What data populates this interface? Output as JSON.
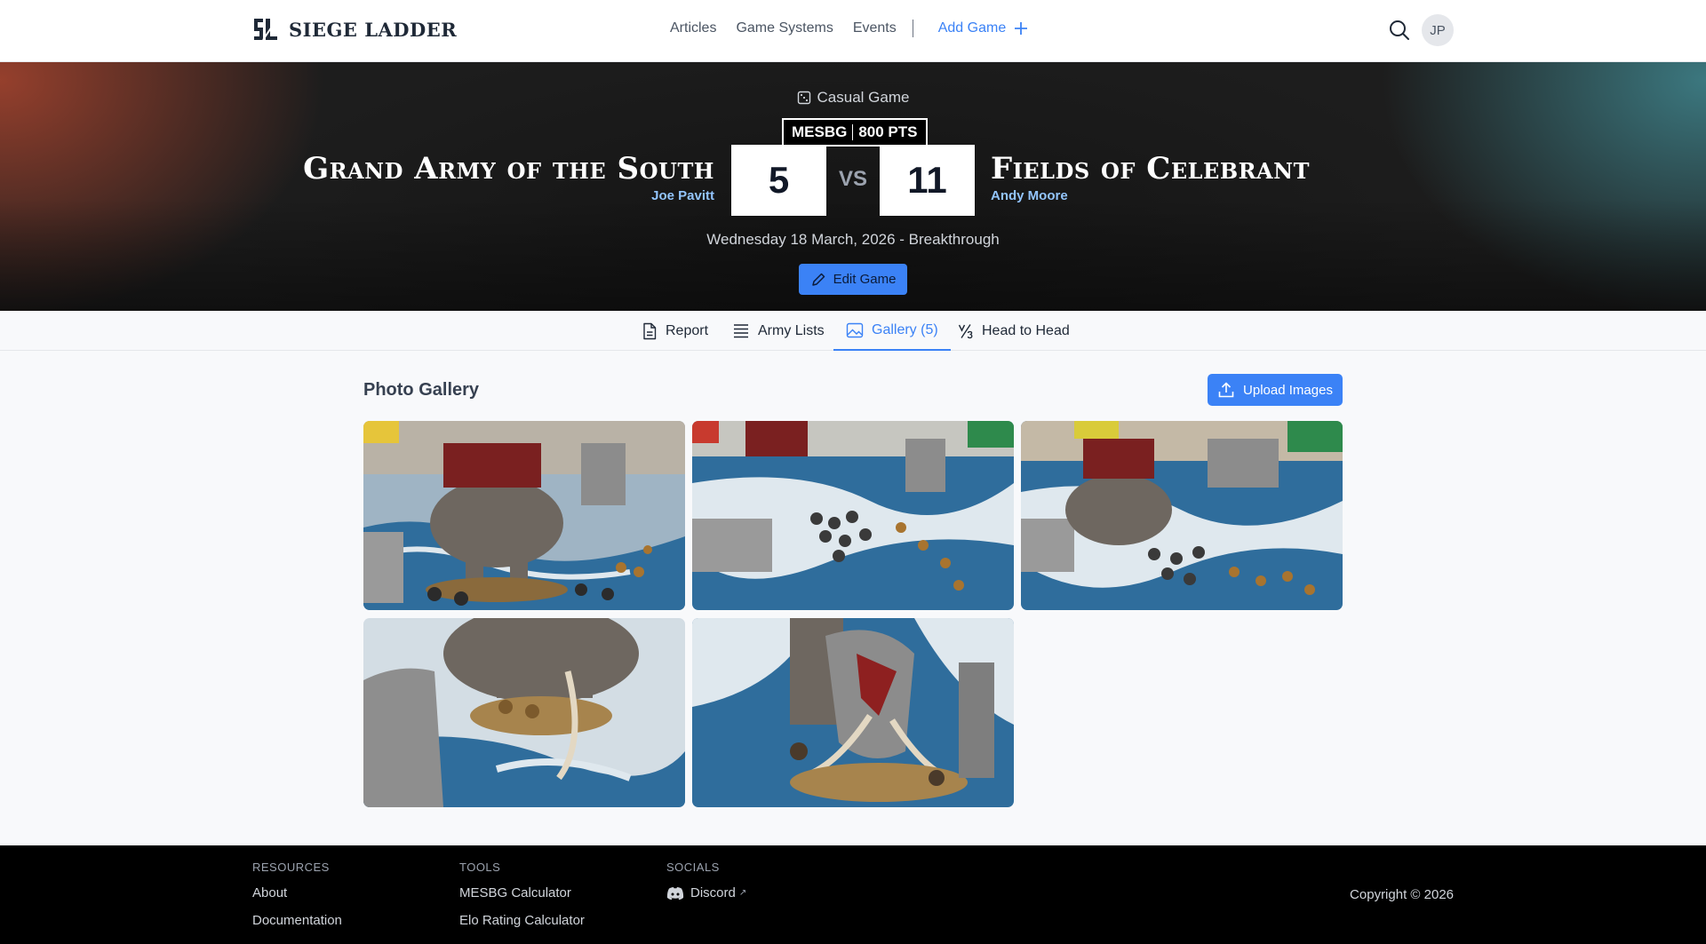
{
  "brand": {
    "name": "SIEGE LADDER"
  },
  "nav": {
    "items": [
      "Articles",
      "Game Systems",
      "Events"
    ],
    "add_game": "Add Game"
  },
  "user": {
    "initials": "JP"
  },
  "game": {
    "type_label": "Casual Game",
    "system": "MESBG",
    "points": "800 PTS",
    "left": {
      "army": "Grand Army of the South",
      "player": "Joe Pavitt",
      "score": "5"
    },
    "right": {
      "army": "Fields of Celebrant",
      "player": "Andy Moore",
      "score": "11"
    },
    "vs": "VS",
    "date_line": "Wednesday 18 March, 2026 - Breakthrough",
    "edit_label": "Edit Game"
  },
  "tabs": [
    {
      "label": "Report",
      "active": false
    },
    {
      "label": "Army Lists",
      "active": false
    },
    {
      "label": "Gallery (5)",
      "active": true
    },
    {
      "label": "Head to Head",
      "active": false
    }
  ],
  "gallery": {
    "title": "Photo Gallery",
    "upload_label": "Upload Images",
    "photos": [
      {
        "icon": "war-elephant-photo"
      },
      {
        "icon": "army-formation-photo"
      },
      {
        "icon": "battlefield-overview-photo"
      },
      {
        "icon": "elephant-closeup-photo"
      },
      {
        "icon": "elephant-front-photo"
      }
    ]
  },
  "footer": {
    "resources": {
      "heading": "RESOURCES",
      "links": [
        "About",
        "Documentation"
      ]
    },
    "tools": {
      "heading": "TOOLS",
      "links": [
        "MESBG Calculator",
        "Elo Rating Calculator"
      ]
    },
    "socials": {
      "heading": "SOCIALS",
      "links": [
        "Discord"
      ]
    },
    "copyright": "Copyright © 2026"
  },
  "colors": {
    "accent": "#3b82f6",
    "player_link": "#93c5fd",
    "footer_bg": "#000000"
  }
}
